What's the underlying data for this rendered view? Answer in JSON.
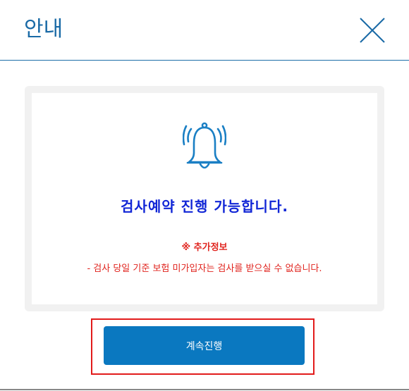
{
  "dialog": {
    "title": "안내",
    "close_icon": "close-icon"
  },
  "content": {
    "icon": "bell-icon",
    "message": "검사예약 진행 가능합니다.",
    "info_title": "※ 추가정보",
    "info_text": "- 검사 당일 기준 보험 미가입자는 검사를 받으실 수 없습니다."
  },
  "actions": {
    "continue_label": "계속진행"
  },
  "colors": {
    "accent": "#1a6aa6",
    "message": "#1126d6",
    "warning": "#e0231d",
    "button": "#0a78c0",
    "highlight": "#e21b1b"
  }
}
